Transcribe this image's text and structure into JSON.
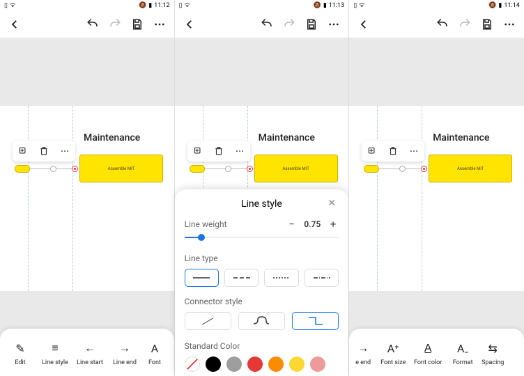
{
  "panes": [
    {
      "time": "11:12"
    },
    {
      "time": "11:13"
    },
    {
      "time": "11:14"
    }
  ],
  "header_label": "Maintenance",
  "task_label": "Assemble MIT",
  "toolstrip_a": [
    {
      "icon": "✎",
      "label": "Edit",
      "name": "tool-edit"
    },
    {
      "icon": "≡",
      "label": "Line style",
      "name": "tool-line-style"
    },
    {
      "icon": "←",
      "label": "Line start",
      "name": "tool-line-start"
    },
    {
      "icon": "→",
      "label": "Line end",
      "name": "tool-line-end"
    },
    {
      "icon": "A",
      "label": "Font",
      "name": "tool-font",
      "partial": "right"
    }
  ],
  "toolstrip_c": [
    {
      "icon": "→",
      "label": "e end",
      "name": "tool-line-end",
      "partial": "left"
    },
    {
      "icon": "A⁺",
      "label": "Font size",
      "name": "tool-font-size"
    },
    {
      "icon": "A̲",
      "label": "Font color",
      "name": "tool-font-color"
    },
    {
      "icon": "A₋",
      "label": "Format",
      "name": "tool-format"
    },
    {
      "icon": "⇆",
      "label": "Spacing",
      "name": "tool-spacing",
      "partial": "right"
    }
  ],
  "modal": {
    "title": "Line style",
    "weight_label": "Line weight",
    "weight_value": "0.75",
    "type_label": "Line type",
    "types": [
      "solid",
      "dash-long",
      "dash-short",
      "dash-dot"
    ],
    "connector_label": "Connector style",
    "color_label": "Standard Color",
    "colors": [
      "none",
      "#000000",
      "#9e9e9e",
      "#e53935",
      "#fb8c00",
      "#fdd835",
      "#ef9a9a"
    ]
  }
}
